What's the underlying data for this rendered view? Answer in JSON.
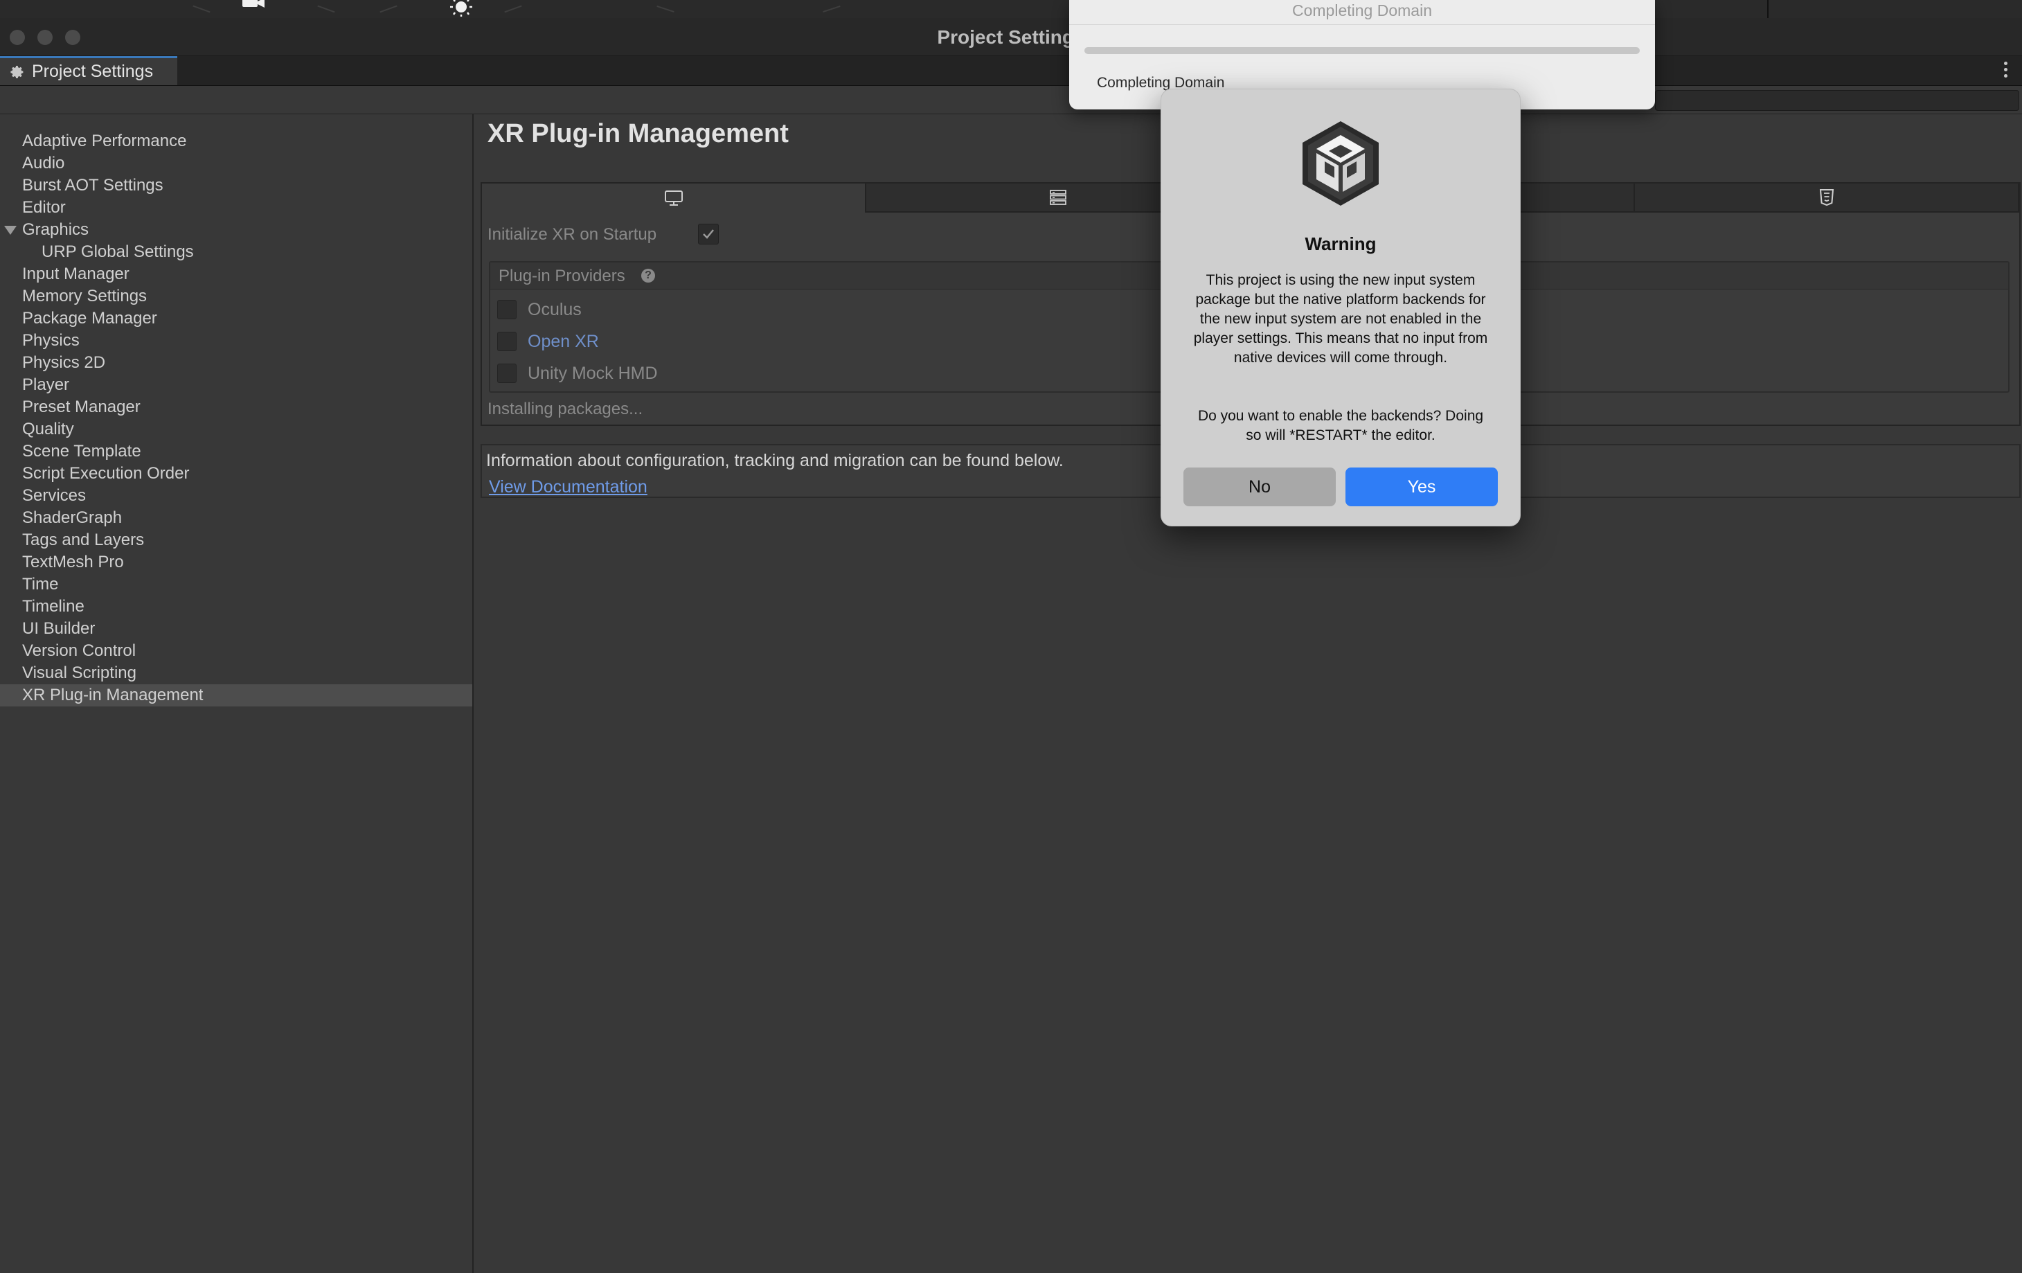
{
  "window": {
    "title": "Project Settings"
  },
  "tab": {
    "label": "Project Settings"
  },
  "sidebar": {
    "items": [
      {
        "label": "Adaptive Performance"
      },
      {
        "label": "Audio"
      },
      {
        "label": "Burst AOT Settings"
      },
      {
        "label": "Editor"
      },
      {
        "label": "Graphics",
        "expanded": true
      },
      {
        "label": "URP Global Settings",
        "child": true
      },
      {
        "label": "Input Manager"
      },
      {
        "label": "Memory Settings"
      },
      {
        "label": "Package Manager"
      },
      {
        "label": "Physics"
      },
      {
        "label": "Physics 2D"
      },
      {
        "label": "Player"
      },
      {
        "label": "Preset Manager"
      },
      {
        "label": "Quality"
      },
      {
        "label": "Scene Template"
      },
      {
        "label": "Script Execution Order"
      },
      {
        "label": "Services"
      },
      {
        "label": "ShaderGraph"
      },
      {
        "label": "Tags and Layers"
      },
      {
        "label": "TextMesh Pro"
      },
      {
        "label": "Time"
      },
      {
        "label": "Timeline"
      },
      {
        "label": "UI Builder"
      },
      {
        "label": "Version Control"
      },
      {
        "label": "Visual Scripting"
      },
      {
        "label": "XR Plug-in Management",
        "selected": true
      }
    ]
  },
  "main": {
    "title": "XR Plug-in Management",
    "platform_tabs": [
      {
        "icon": "monitor-icon",
        "active": true
      },
      {
        "icon": "server-icon"
      },
      {
        "icon": "android-icon"
      },
      {
        "icon": "html5-icon"
      }
    ],
    "initialize_label": "Initialize XR on Startup",
    "initialize_checked": true,
    "providers_label": "Plug-in Providers",
    "providers": [
      {
        "label": "Oculus",
        "checked": false
      },
      {
        "label": "Open XR",
        "checked": false,
        "link": true
      },
      {
        "label": "Unity Mock HMD",
        "checked": false
      }
    ],
    "installing_text": "Installing packages...",
    "info_text": "Information about configuration, tracking and migration can be found below.",
    "doc_link": "View Documentation"
  },
  "progress": {
    "title": "Completing Domain",
    "status": "Completing Domain",
    "fraction": 0.0
  },
  "dialog": {
    "title": "Warning",
    "message": "This project is using the new input system package but the native platform backends for the new input system are not enabled in the player settings. This means that no input from native devices will come through.",
    "question": "Do you want to enable the backends? Doing so will *RESTART* the editor.",
    "no_label": "No",
    "yes_label": "Yes"
  },
  "colors": {
    "accent": "#2f7df6",
    "link": "#6f9be8",
    "panel": "#383838"
  }
}
